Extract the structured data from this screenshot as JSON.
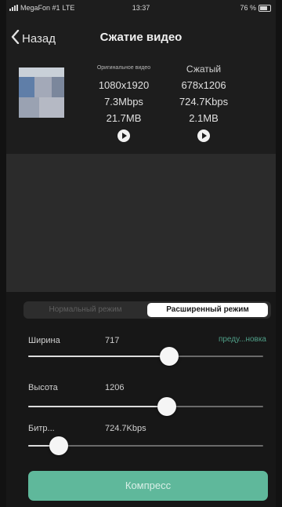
{
  "status": {
    "carrier": "MegaFon #1",
    "network": "LTE",
    "time": "13:37",
    "battery": "76 %"
  },
  "nav": {
    "back_label": "Назад",
    "title": "Сжатие видео"
  },
  "info": {
    "original_header": "Оригинальное видео",
    "compressed_header": "Сжатый",
    "original": {
      "resolution": "1080x1920",
      "bitrate": "7.3Mbps",
      "size": "21.7MB"
    },
    "compressed": {
      "resolution": "678x1206",
      "bitrate": "724.7Kbps",
      "size": "2.1MB"
    }
  },
  "modes": {
    "basic_label": "Нормальный режим",
    "advanced_label": "Расширенный режим",
    "selected": "advanced"
  },
  "settings": {
    "width": {
      "label": "Ширина",
      "value": "717",
      "level": 0.6
    },
    "height": {
      "label": "Высота",
      "value": "1206",
      "level": 0.59
    },
    "bitrate": {
      "label": "Битр...",
      "value": "724.7Kbps",
      "level": 0.13
    },
    "preset_link": "преду...новка"
  },
  "compress_label": "Компресс",
  "colors": {
    "accent": "#5fb89b",
    "link": "#4f9e87",
    "background": "#1d1d1d"
  }
}
